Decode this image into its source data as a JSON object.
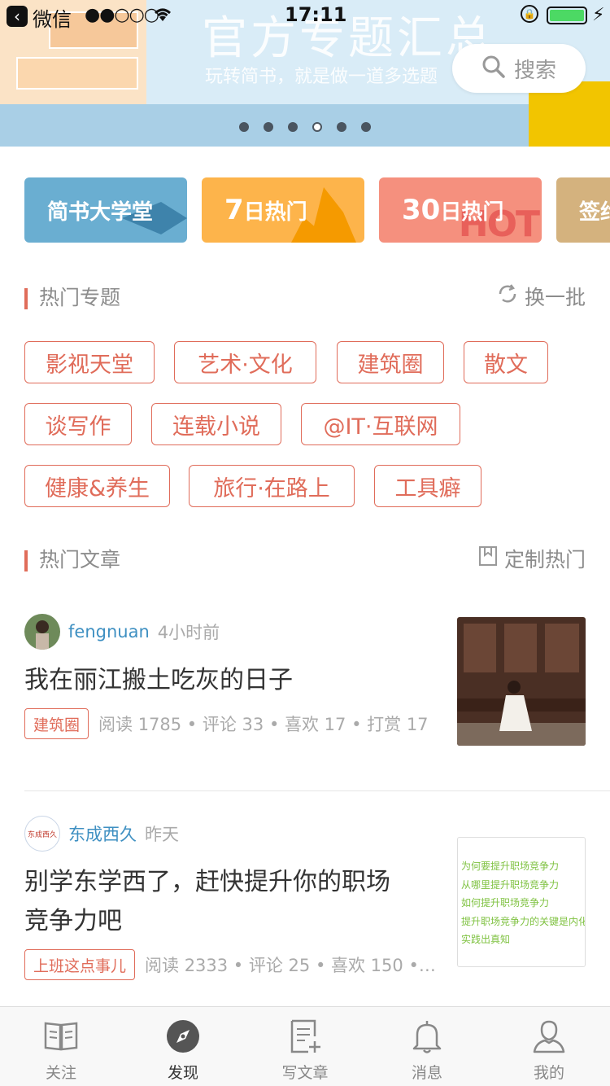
{
  "status_bar": {
    "app_name": "微信",
    "signal": "●●○○○",
    "time": "17:11"
  },
  "banner": {
    "title": "官方专题汇总",
    "subtitle": "玩转简书，就是做一道多选题",
    "active_dot": 3,
    "dot_count": 6
  },
  "search": {
    "label": "搜索"
  },
  "categories": [
    {
      "label": "简书大学堂"
    },
    {
      "big": "7",
      "label": "日热门"
    },
    {
      "big": "30",
      "label": "日热门",
      "deco": "HOT"
    },
    {
      "label": "签约"
    }
  ],
  "hot_topics": {
    "title": "热门专题",
    "action": "换一批",
    "tags": [
      "影视天堂",
      "艺术·文化",
      "建筑圈",
      "散文",
      "谈写作",
      "连载小说",
      "@IT·互联网",
      "健康&养生",
      "旅行·在路上",
      "工具癖"
    ]
  },
  "hot_articles": {
    "title": "热门文章",
    "action": "定制热门",
    "items": [
      {
        "author": "fengnuan",
        "time": "4小时前",
        "title": "我在丽江搬土吃灰的日子",
        "tag": "建筑圈",
        "meta": "阅读 1785 • 评论 33 • 喜欢 17 • 打赏 17"
      },
      {
        "author": "东成西久",
        "avatar_text": "东成西久",
        "time": "昨天",
        "title_line1": "别学东学西了，赶快提升你的职场",
        "title_line2": "竞争力吧",
        "tag": "上班这点事儿",
        "meta": "阅读 2333 • 评论 25 • 喜欢 150 •…",
        "thumb_lines": [
          "为何要提升职场竞争力",
          "从哪里提升职场竞争力",
          "如何提升职场竞争力",
          "提升职场竞争力的关键是内化",
          "实践出真知"
        ]
      }
    ]
  },
  "tabbar": [
    {
      "label": "关注",
      "icon": "follow-icon"
    },
    {
      "label": "发现",
      "icon": "compass-icon",
      "active": true
    },
    {
      "label": "写文章",
      "icon": "write-icon"
    },
    {
      "label": "消息",
      "icon": "bell-icon"
    },
    {
      "label": "我的",
      "icon": "user-icon"
    }
  ],
  "colors": {
    "accent": "#e06c5a",
    "link": "#3f90c2",
    "card_blue": "#6aaed1",
    "card_orange": "#fdb44b",
    "card_salmon": "#f5907e",
    "card_tan": "#d4b27e"
  }
}
